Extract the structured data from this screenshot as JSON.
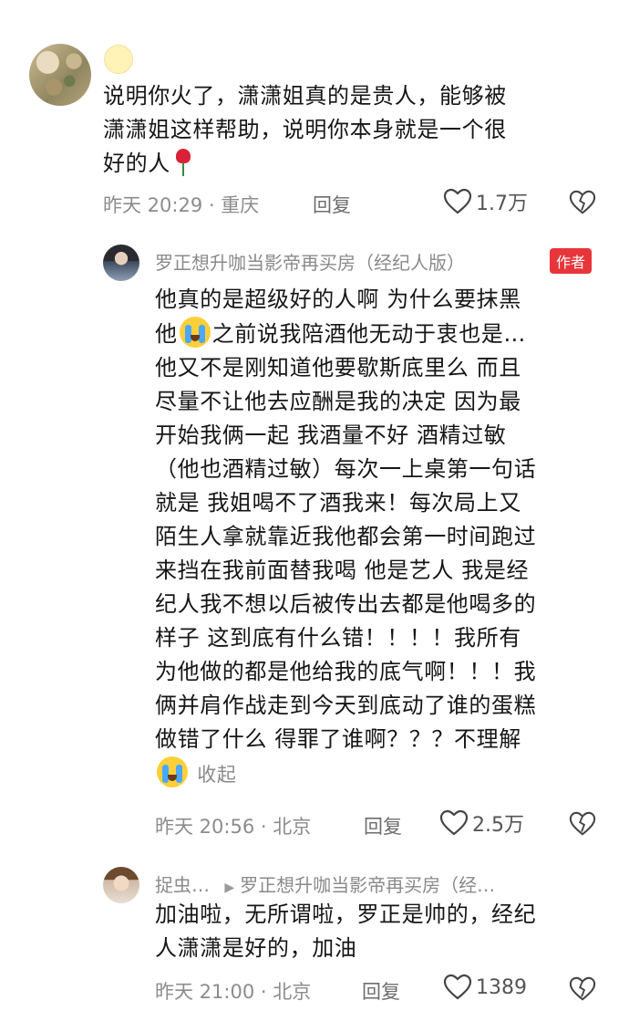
{
  "comment1": {
    "text_lines": [
      "说明你火了，潇潇姐真的是贵人，能够被",
      "潇潇姐这样帮助，说明你本身就是一个很",
      "好的人"
    ],
    "time": "昨天 20:29",
    "location": "重庆",
    "reply_label": "回复",
    "likes": "1.7万"
  },
  "comment2": {
    "author": "罗正想升咖当影帝再买房（经纪人版）",
    "badge": "作者",
    "text_lines": [
      "他真的是超级好的人啊 为什么要抹黑",
      "他",
      "之前说我陪酒他无动于衷也是…",
      "他又不是刚知道他要歇斯底里么 而且",
      "尽量不让他去应酬是我的决定 因为最",
      "开始我俩一起 我酒量不好 酒精过敏",
      "（他也酒精过敏）每次一上桌第一句话",
      "就是 我姐喝不了酒我来！每次局上又",
      "陌生人拿就靠近我他都会第一时间跑过",
      "来挡在我前面替我喝 他是艺人 我是经",
      "纪人我不想以后被传出去都是他喝多的",
      "样子 这到底有什么错！！！！我所有",
      "为他做的都是他给我的底气啊！！！我",
      "俩并肩作战走到今天到底动了谁的蛋糕",
      "做错了什么 得罪了谁啊？？？不理解"
    ],
    "collapse_label": "收起",
    "time": "昨天 20:56",
    "location": "北京",
    "reply_label": "回复",
    "likes": "2.5万"
  },
  "comment3": {
    "author": "捉虫…",
    "reply_to": "罗正想升咖当影帝再买房（经…",
    "text_lines": [
      "加油啦，无所谓啦，罗正是帅的，经纪",
      "人潇潇是好的，加油"
    ],
    "time": "昨天 21:00",
    "location": "北京",
    "reply_label": "回复",
    "likes": "1389"
  },
  "icons": [
    "heart-icon",
    "dislike-heart-icon",
    "crying-emoji-icon",
    "rose-emoji-icon",
    "triangle-right-icon"
  ]
}
